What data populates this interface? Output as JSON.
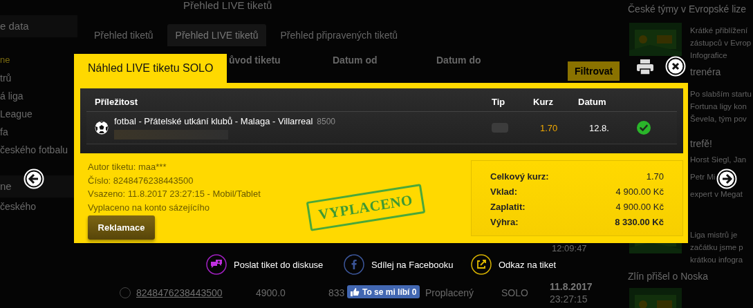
{
  "page": {
    "breadcrumb": "Přehled LIVE tiketů",
    "sidebar": {
      "items": [
        {
          "label": "e data",
          "kind": "panel"
        },
        {
          "label": "ne",
          "kind": "heading"
        },
        {
          "label": "trů",
          "kind": "link"
        },
        {
          "label": "á liga",
          "kind": "link"
        },
        {
          "label": "League",
          "kind": "link"
        },
        {
          "label": "fa",
          "kind": "link"
        },
        {
          "label": "českého fotbalu",
          "kind": "link"
        },
        {
          "label": "ne",
          "kind": "panel"
        },
        {
          "label": "českého",
          "kind": "link"
        }
      ]
    },
    "tabs": [
      {
        "label": "Přehled tiketů",
        "selected": false
      },
      {
        "label": "Přehled LIVE tiketů",
        "selected": true
      },
      {
        "label": "Přehled připravených tiketů",
        "selected": false
      }
    ],
    "filter": {
      "labels": [
        "ůvod tiketu",
        "Datum od",
        "Datum do"
      ],
      "button": "Filtrovat"
    },
    "time_fragment": "12:09:47",
    "tickets": [
      {
        "cells": [
          "8248476238443500",
          "4900.0",
          "833",
          "Proplacený",
          "SOLO"
        ],
        "date": "11.8.2017",
        "time": "23:27:15"
      }
    ],
    "aside": {
      "sections": [
        {
          "kind": "media",
          "heading": "České týmy v Evropské lize",
          "lines": [
            "Krátké přiblížení",
            "zástupců v Evrop",
            "Infografice"
          ]
        },
        {
          "kind": "text",
          "heading": "trenéra",
          "lines": [
            "Po slabším startu",
            "Fortuna ligy kon",
            "Ševela, tým pov"
          ]
        },
        {
          "kind": "text",
          "heading": "trefě!",
          "lines": [
            "Horst Siegl, Jan",
            "Petr Mi",
            "expert v Megat"
          ]
        },
        {
          "kind": "media",
          "lines": [
            "Liga mistrů je",
            "začátku jsme p",
            "krátkou infogra"
          ]
        },
        {
          "kind": "media",
          "heading": "Zlín přišel o Noska"
        }
      ]
    }
  },
  "modal": {
    "title": "Náhled LIVE tiketu SOLO",
    "columns": [
      "Příležitost",
      "Tip",
      "Kurz",
      "Datum"
    ],
    "rows": [
      {
        "event": "fotbal - Přátelské utkání klubů - Malaga - Villarreal",
        "code": "8500",
        "odds": "1.70",
        "date": "12.8.",
        "won": true
      }
    ],
    "info": [
      "Autor tiketu: maa***",
      "Číslo: 8248476238443500",
      "Vsazeno: 11.8.2017 23:27:15 - Mobil/Tablet",
      "Vyplaceno na konto sázejícího"
    ],
    "claim_button": "Reklamace",
    "stamp": "VYPLACENO",
    "summary": [
      {
        "label": "Celkový kurz:",
        "value": "1.70",
        "bold": false
      },
      {
        "label": "Vklad:",
        "value": "4 900.00 Kč",
        "bold": false
      },
      {
        "label": "Zaplatit:",
        "value": "4 900.00 Kč",
        "bold": false
      },
      {
        "label": "Výhra:",
        "value": "8 330.00 Kč",
        "bold": true
      }
    ],
    "actions": [
      {
        "kind": "discuss",
        "label": "Poslat tiket do diskuse"
      },
      {
        "kind": "facebook",
        "label": "Sdílej na Facebooku"
      },
      {
        "kind": "link",
        "label": "Odkaz na tiket"
      }
    ],
    "like_button": "To se mi líbí 0"
  }
}
